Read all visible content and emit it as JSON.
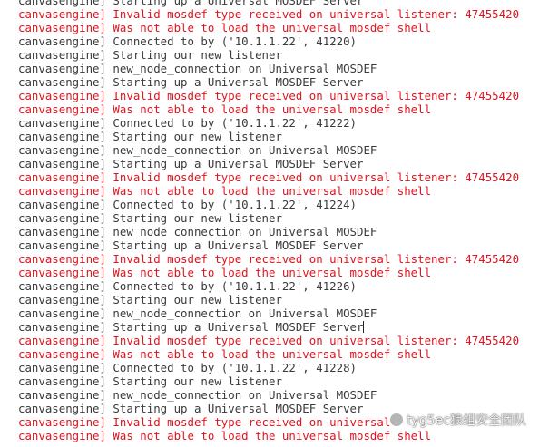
{
  "terminal": {
    "lines": [
      {
        "text": "canvasengine] Starting up a Universal MOSDEF Server",
        "type": "normal"
      },
      {
        "text": "canvasengine] Invalid mosdef type received on universal listener: 47455420",
        "type": "error"
      },
      {
        "text": "canvasengine] Was not able to load the universal mosdef shell",
        "type": "error"
      },
      {
        "text": "canvasengine] Connected to by ('10.1.1.22', 41220)",
        "type": "normal"
      },
      {
        "text": "canvasengine] Starting our new listener",
        "type": "normal"
      },
      {
        "text": "canvasengine] new_node_connection on Universal MOSDEF",
        "type": "normal"
      },
      {
        "text": "canvasengine] Starting up a Universal MOSDEF Server",
        "type": "normal"
      },
      {
        "text": "canvasengine] Invalid mosdef type received on universal listener: 47455420",
        "type": "error"
      },
      {
        "text": "canvasengine] Was not able to load the universal mosdef shell",
        "type": "error"
      },
      {
        "text": "canvasengine] Connected to by ('10.1.1.22', 41222)",
        "type": "normal"
      },
      {
        "text": "canvasengine] Starting our new listener",
        "type": "normal"
      },
      {
        "text": "canvasengine] new_node_connection on Universal MOSDEF",
        "type": "normal"
      },
      {
        "text": "canvasengine] Starting up a Universal MOSDEF Server",
        "type": "normal"
      },
      {
        "text": "canvasengine] Invalid mosdef type received on universal listener: 47455420",
        "type": "error"
      },
      {
        "text": "canvasengine] Was not able to load the universal mosdef shell",
        "type": "error"
      },
      {
        "text": "canvasengine] Connected to by ('10.1.1.22', 41224)",
        "type": "normal"
      },
      {
        "text": "canvasengine] Starting our new listener",
        "type": "normal"
      },
      {
        "text": "canvasengine] new_node_connection on Universal MOSDEF",
        "type": "normal"
      },
      {
        "text": "canvasengine] Starting up a Universal MOSDEF Server",
        "type": "normal"
      },
      {
        "text": "canvasengine] Invalid mosdef type received on universal listener: 47455420",
        "type": "error"
      },
      {
        "text": "canvasengine] Was not able to load the universal mosdef shell",
        "type": "error"
      },
      {
        "text": "canvasengine] Connected to by ('10.1.1.22', 41226)",
        "type": "normal"
      },
      {
        "text": "canvasengine] Starting our new listener",
        "type": "normal"
      },
      {
        "text": "canvasengine] new_node_connection on Universal MOSDEF",
        "type": "normal"
      },
      {
        "text": "canvasengine] Starting up a Universal MOSDEF Server",
        "type": "normal",
        "cursor": true
      },
      {
        "text": "canvasengine] Invalid mosdef type received on universal listener: 47455420",
        "type": "error"
      },
      {
        "text": "canvasengine] Was not able to load the universal mosdef shell",
        "type": "error"
      },
      {
        "text": "canvasengine] Connected to by ('10.1.1.22', 41228)",
        "type": "normal"
      },
      {
        "text": "canvasengine] Starting our new listener",
        "type": "normal"
      },
      {
        "text": "canvasengine] new_node_connection on Universal MOSDEF",
        "type": "normal"
      },
      {
        "text": "canvasengine] Starting up a Universal MOSDEF Server",
        "type": "normal"
      },
      {
        "text": "canvasengine] Invalid mosdef type received on universal",
        "type": "error"
      },
      {
        "text": "canvasengine] Was not able to load the universal mosdef shell",
        "type": "error"
      }
    ],
    "colors": {
      "normal": "#3a3a3a",
      "error": "#e0141e",
      "background": "#ffffff"
    }
  },
  "watermark": {
    "text": "tyg5ec狼组安全团队",
    "icon": "wechat-logo-icon"
  }
}
